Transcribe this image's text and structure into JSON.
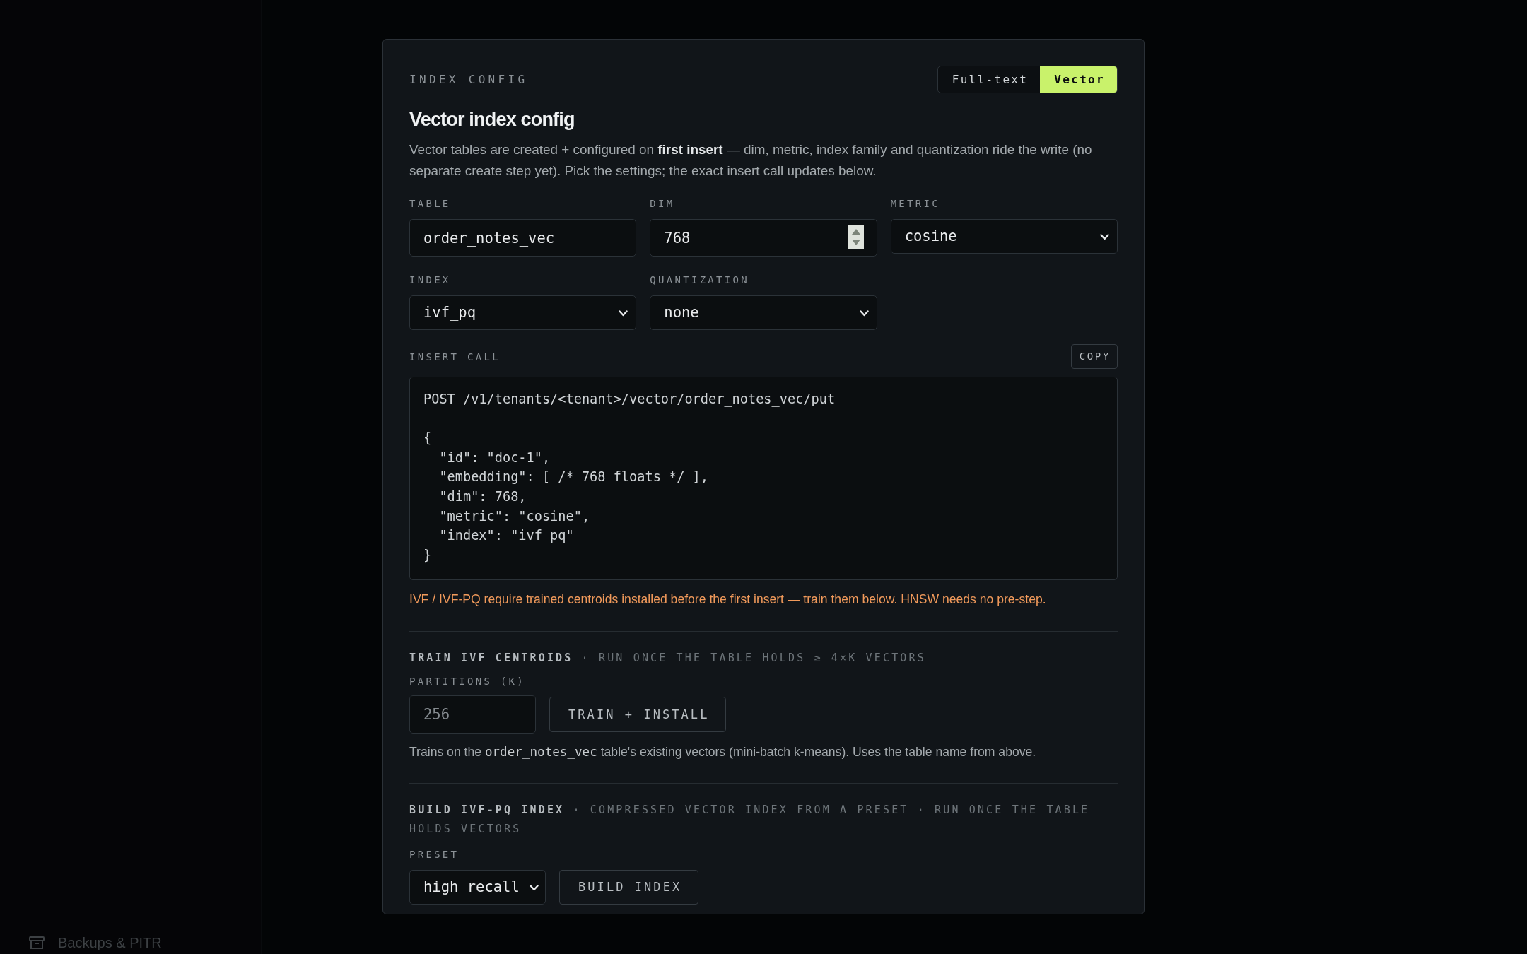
{
  "sidebar": {
    "items": [
      {
        "label": "Backups & PITR"
      }
    ]
  },
  "modal": {
    "eyebrow": "INDEX CONFIG",
    "mode_tabs": [
      {
        "label": "Full-text",
        "selected": false
      },
      {
        "label": "Vector",
        "selected": true
      }
    ],
    "title": "Vector index config",
    "description": "Vector tables are created + configured on **first insert** — dim, metric, index family and quantization ride the write (no separate create step yet). Pick the settings; the exact insert call updates below.",
    "fields": [
      {
        "kind": "text",
        "label": "TABLE",
        "value": "order_notes_vec"
      },
      {
        "kind": "number",
        "label": "DIM",
        "value": "768"
      },
      {
        "kind": "select",
        "label": "METRIC",
        "value": "cosine"
      },
      {
        "kind": "select",
        "label": "INDEX",
        "value": "ivf_pq"
      },
      {
        "kind": "select",
        "label": "QUANTIZATION",
        "value": "none"
      }
    ],
    "insert_call": {
      "label": "INSERT CALL",
      "copy_button": "COPY",
      "code": "POST /v1/tenants/<tenant>/vector/order_notes_vec/put\n\n{\n  \"id\": \"doc-1\",\n  \"embedding\": [ /* 768 floats */ ],\n  \"dim\": 768,\n  \"metric\": \"cosine\",\n  \"index\": \"ivf_pq\"\n}"
    },
    "warning": "IVF / IVF-PQ require trained centroids installed before the first insert — train them below. HNSW needs no pre-step.",
    "train": {
      "heading": "**TRAIN IVF CENTROIDS** · RUN ONCE THE TABLE HOLDS ≥ 4×K VECTORS",
      "field_label": "PARTITIONS (K)",
      "placeholder": "256",
      "button": "TRAIN + INSTALL",
      "help_before": "Trains on the",
      "help_code": "order_notes_vec",
      "help_after": "table's existing vectors (mini-batch k-means). Uses the table name from above."
    },
    "build": {
      "heading": "**BUILD IVF-PQ INDEX** · COMPRESSED VECTOR INDEX FROM A PRESET · RUN ONCE THE TABLE HOLDS VECTORS",
      "field_label": "PRESET",
      "value": "high_recall",
      "button": "BUILD INDEX"
    }
  }
}
